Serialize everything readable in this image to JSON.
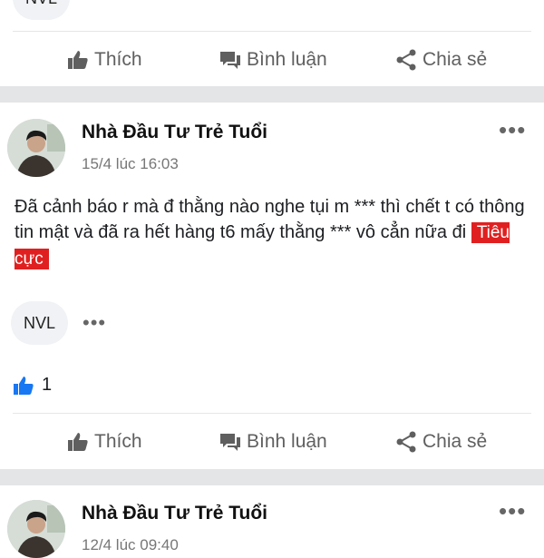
{
  "posts": [
    {
      "tag_chip": "NVL",
      "actions": {
        "like": "Thích",
        "comment": "Bình luận",
        "share": "Chia sẻ"
      }
    },
    {
      "author": "Nhà Đầu Tư Trẻ Tuổi",
      "time": "15/4 lúc 16:03",
      "text": "Đã cảnh báo r mà đ thằng nào nghe  tụi m *** thì chết t có thông tin mật và đã ra hết hàng t6 mấy thằng *** vô cẳn nữa đi",
      "sentiment_tag": "Tiêu cực",
      "tag_chip": "NVL",
      "more": "•••",
      "likes": "1",
      "actions": {
        "like": "Thích",
        "comment": "Bình luận",
        "share": "Chia sẻ"
      }
    },
    {
      "author": "Nhà Đầu Tư Trẻ Tuổi",
      "time": "12/4 lúc 09:40",
      "more": "•••"
    }
  ],
  "colors": {
    "like_blue": "#1877f2",
    "negative_red": "#e02020",
    "separator": "#e4e5e7"
  },
  "icons": [
    "thumbs-up-icon",
    "comment-icon",
    "share-icon",
    "more-icon"
  ]
}
